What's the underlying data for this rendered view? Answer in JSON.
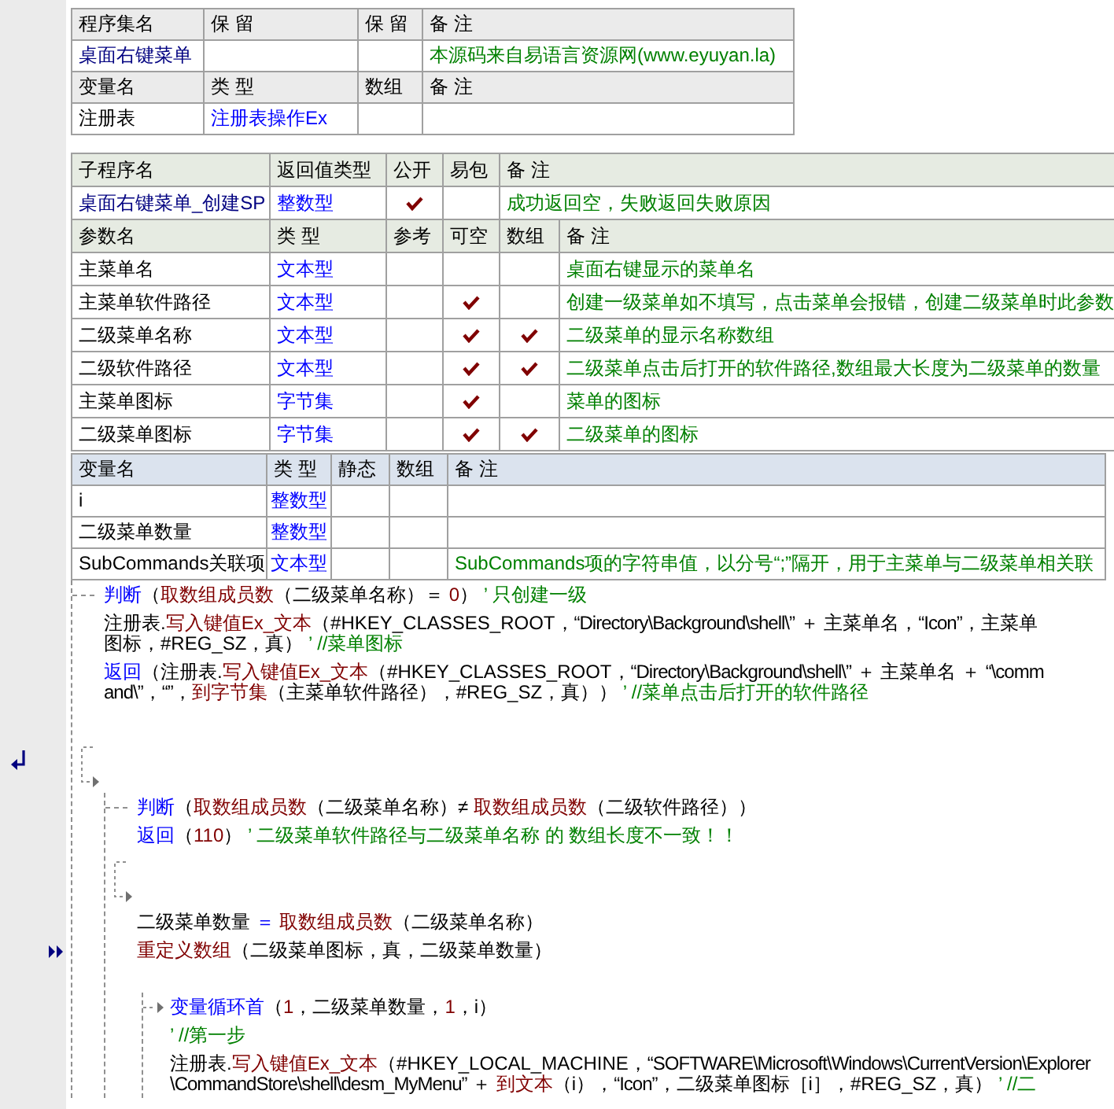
{
  "assembly": {
    "header": [
      "程序集名",
      "保 留",
      "保 留",
      "备 注"
    ],
    "name": "桌面右键菜单",
    "remark": "本源码来自易语言资源网(www.eyuyan.la)"
  },
  "assembly_vars": {
    "header": [
      "变量名",
      "类 型",
      "数组",
      "备 注"
    ],
    "rows": [
      {
        "name": "注册表",
        "type": "注册表操作Ex",
        "array": false
      }
    ]
  },
  "subroutine": {
    "header": [
      "子程序名",
      "返回值类型",
      "公开",
      "易包",
      "备 注"
    ],
    "name": "桌面右键菜单_创建SP",
    "return_type": "整数型",
    "public": true,
    "easy_package": false,
    "remark": "成功返回空，失败返回失败原因"
  },
  "params": {
    "header": [
      "参数名",
      "类 型",
      "参考",
      "可空",
      "数组",
      "备 注"
    ],
    "rows": [
      {
        "name": "主菜单名",
        "type": "文本型",
        "reference": false,
        "optional": false,
        "array": false,
        "remark": "桌面右键显示的菜单名"
      },
      {
        "name": "主菜单软件路径",
        "type": "文本型",
        "reference": false,
        "optional": true,
        "array": false,
        "remark": "创建一级菜单如不填写，点击菜单会报错，创建二级菜单时此参数"
      },
      {
        "name": "二级菜单名称",
        "type": "文本型",
        "reference": false,
        "optional": true,
        "array": true,
        "remark": "二级菜单的显示名称数组"
      },
      {
        "name": "二级软件路径",
        "type": "文本型",
        "reference": false,
        "optional": true,
        "array": true,
        "remark": "二级菜单点击后打开的软件路径,数组最大长度为二级菜单的数量"
      },
      {
        "name": "主菜单图标",
        "type": "字节集",
        "reference": false,
        "optional": true,
        "array": false,
        "remark": "菜单的图标"
      },
      {
        "name": "二级菜单图标",
        "type": "字节集",
        "reference": false,
        "optional": true,
        "array": true,
        "remark": "二级菜单的图标"
      }
    ]
  },
  "locals": {
    "header": [
      "变量名",
      "类 型",
      "静态",
      "数组",
      "备 注"
    ],
    "rows": [
      {
        "name": "i",
        "type": "整数型",
        "static": false,
        "array": false
      },
      {
        "name": "二级菜单数量",
        "type": "整数型",
        "static": false,
        "array": false
      },
      {
        "name": "SubCommands关联项",
        "type": "文本型",
        "static": false,
        "array": false,
        "remark": "SubCommands项的字符串值，以分号“;”隔开，用于主菜单与二级菜单相关联"
      }
    ]
  },
  "code": [
    {
      "kind": "if",
      "jump_mark": true,
      "head": {
        "segments": [
          {
            "kind": "kw",
            "text": "判断"
          },
          {
            "kind": "txt",
            "text": "（"
          },
          {
            "kind": "fn",
            "text": "取数组成员数"
          },
          {
            "kind": "txt",
            "text": "（二级菜单名称）＝ "
          },
          {
            "kind": "fn",
            "text": "0"
          },
          {
            "kind": "txt",
            "text": "）"
          },
          {
            "kind": "cmt",
            "text": " ’ 只创建一级"
          }
        ]
      },
      "then": [
        {
          "kind": "line",
          "lines": [
            {
              "segments": [
                {
                  "kind": "txt",
                  "text": "注册表."
                },
                {
                  "kind": "fn",
                  "text": "写入键值Ex_文本"
                },
                {
                  "kind": "txt",
                  "text": "（#HKEY_CLASSES_ROOT，"
                },
                {
                  "kind": "str",
                  "text": "“Directory\\Background\\shell\\”"
                },
                {
                  "kind": "txt",
                  "text": " ＋ 主菜单名，"
                },
                {
                  "kind": "str",
                  "text": "“Icon”"
                },
                {
                  "kind": "txt",
                  "text": "，主菜单"
                }
              ]
            },
            {
              "segments": [
                {
                  "kind": "txt",
                  "text": "图标，#REG_SZ，真）"
                },
                {
                  "kind": "cmt",
                  "text": " ’ //菜单图标"
                }
              ]
            }
          ]
        },
        {
          "kind": "line",
          "lines": [
            {
              "segments": [
                {
                  "kind": "kw",
                  "text": "返回"
                },
                {
                  "kind": "txt",
                  "text": "（注册表."
                },
                {
                  "kind": "fn",
                  "text": "写入键值Ex_文本"
                },
                {
                  "kind": "txt",
                  "text": "（#HKEY_CLASSES_ROOT，"
                },
                {
                  "kind": "str",
                  "text": "“Directory\\Background\\shell\\”"
                },
                {
                  "kind": "txt",
                  "text": " ＋ 主菜单名 ＋ "
                },
                {
                  "kind": "str",
                  "text": "“\\comm"
                }
              ]
            },
            {
              "segments": [
                {
                  "kind": "str",
                  "text": "and\\”"
                },
                {
                  "kind": "txt",
                  "text": "，"
                },
                {
                  "kind": "str",
                  "text": "“”"
                },
                {
                  "kind": "txt",
                  "text": "，"
                },
                {
                  "kind": "fn",
                  "text": "到字节集"
                },
                {
                  "kind": "txt",
                  "text": "（主菜单软件路径），#REG_SZ，真））"
                },
                {
                  "kind": "cmt",
                  "text": " ’ //菜单点击后打开的软件路径"
                }
              ]
            }
          ]
        },
        {
          "kind": "blank"
        }
      ],
      "else": [
        {
          "kind": "if",
          "jump_mark": false,
          "head": {
            "segments": [
              {
                "kind": "kw",
                "text": "判断"
              },
              {
                "kind": "txt",
                "text": "（"
              },
              {
                "kind": "fn",
                "text": "取数组成员数"
              },
              {
                "kind": "txt",
                "text": "（二级菜单名称）≠ "
              },
              {
                "kind": "fn",
                "text": "取数组成员数"
              },
              {
                "kind": "txt",
                "text": "（二级软件路径））"
              }
            ]
          },
          "then": [
            {
              "kind": "line",
              "lines": [
                {
                  "segments": [
                    {
                      "kind": "kw",
                      "text": "返回"
                    },
                    {
                      "kind": "txt",
                      "text": "（"
                    },
                    {
                      "kind": "fn",
                      "text": "110"
                    },
                    {
                      "kind": "txt",
                      "text": "）"
                    },
                    {
                      "kind": "cmt",
                      "text": " ’ 二级菜单软件路径与二级菜单名称 的 数组长度不一致！！"
                    }
                  ]
                }
              ]
            }
          ],
          "else": [
            {
              "kind": "line",
              "lines": [
                {
                  "segments": [
                    {
                      "kind": "txt",
                      "text": "二级菜单数量 "
                    },
                    {
                      "kind": "kw",
                      "text": "＝"
                    },
                    {
                      "kind": "fn",
                      "text": " 取数组成员数"
                    },
                    {
                      "kind": "txt",
                      "text": "（二级菜单名称）"
                    }
                  ]
                }
              ]
            },
            {
              "kind": "line",
              "current_mark": true,
              "lines": [
                {
                  "segments": [
                    {
                      "kind": "fn",
                      "text": "重定义数组"
                    },
                    {
                      "kind": "txt",
                      "text": "（二级菜单图标，真，二级菜单数量）"
                    }
                  ]
                }
              ]
            },
            {
              "kind": "blank"
            },
            {
              "kind": "loop",
              "head": {
                "segments": [
                  {
                    "kind": "kw",
                    "text": "变量循环首"
                  },
                  {
                    "kind": "txt",
                    "text": "（"
                  },
                  {
                    "kind": "fn",
                    "text": "1"
                  },
                  {
                    "kind": "txt",
                    "text": "，二级菜单数量，"
                  },
                  {
                    "kind": "fn",
                    "text": "1"
                  },
                  {
                    "kind": "txt",
                    "text": "，i）"
                  }
                ]
              },
              "children": [
                {
                  "kind": "line",
                  "lines": [
                    {
                      "segments": [
                        {
                          "kind": "cmt",
                          "text": "’ //第一步"
                        }
                      ]
                    }
                  ]
                },
                {
                  "kind": "line",
                  "lines": [
                    {
                      "segments": [
                        {
                          "kind": "txt",
                          "text": "注册表."
                        },
                        {
                          "kind": "fn",
                          "text": "写入键值Ex_文本"
                        },
                        {
                          "kind": "txt",
                          "text": "（#HKEY_LOCAL_MACHINE，"
                        },
                        {
                          "kind": "str",
                          "text": "“SOFTWARE\\Microsoft\\Windows\\CurrentVersion\\Explorer"
                        }
                      ]
                    },
                    {
                      "segments": [
                        {
                          "kind": "str",
                          "text": "\\CommandStore\\shell\\desm_MyMenu”"
                        },
                        {
                          "kind": "txt",
                          "text": " ＋ "
                        },
                        {
                          "kind": "fn",
                          "text": "到文本"
                        },
                        {
                          "kind": "txt",
                          "text": "（i），"
                        },
                        {
                          "kind": "str",
                          "text": "“Icon”"
                        },
                        {
                          "kind": "txt",
                          "text": "，二级菜单图标［i］，#REG_SZ，真）"
                        },
                        {
                          "kind": "cmt",
                          "text": " ’ //二"
                        }
                      ]
                    }
                  ]
                }
              ]
            }
          ]
        }
      ]
    }
  ]
}
